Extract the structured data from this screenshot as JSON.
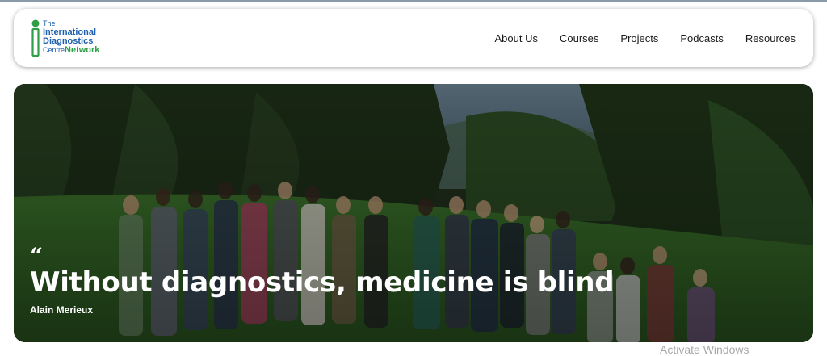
{
  "brand": {
    "line1": "The",
    "line2": "International",
    "line3": "Diagnostics",
    "line4a": "Centre",
    "line4b": "Network",
    "colors": {
      "blue": "#1c5fae",
      "green": "#2e9e47"
    }
  },
  "nav": {
    "items": [
      {
        "label": "About Us"
      },
      {
        "label": "Courses"
      },
      {
        "label": "Projects"
      },
      {
        "label": "Podcasts"
      },
      {
        "label": "Resources"
      }
    ]
  },
  "hero": {
    "quote_mark": "“",
    "quote": "Without diagnostics, medicine is blind",
    "author": "Alain Merieux",
    "image": "group-photo"
  },
  "watermark": "Activate Windows"
}
